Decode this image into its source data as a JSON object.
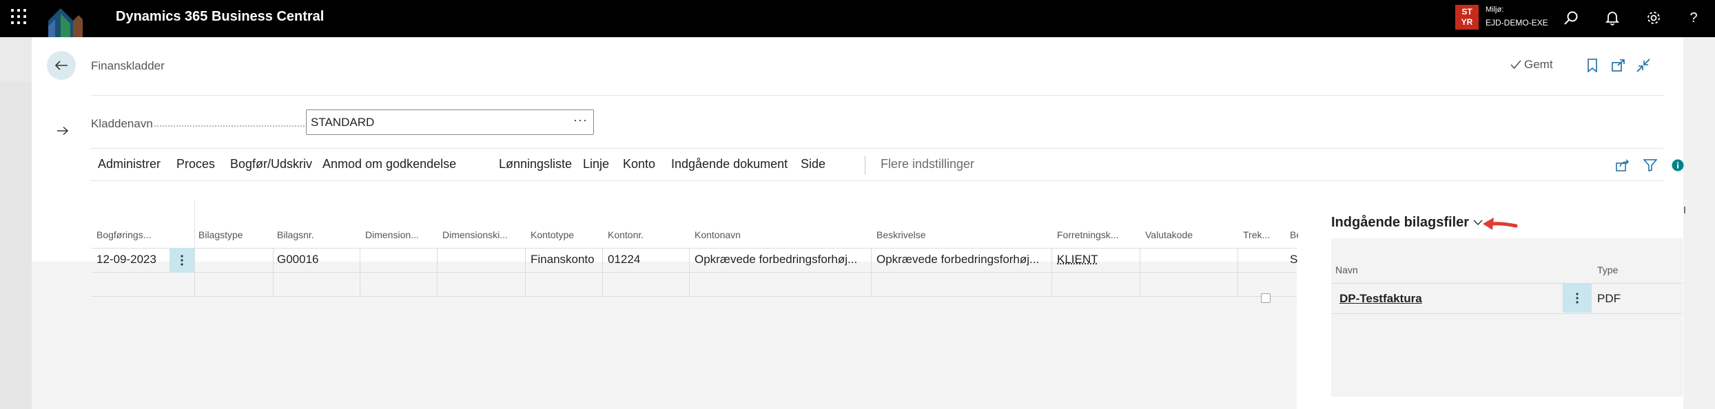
{
  "topbar": {
    "app_title": "Dynamics 365 Business Central",
    "env_badge_line1": "ST",
    "env_badge_line2": "YR",
    "env_label": "Miljø:",
    "env_name": "EJD-DEMO-EXE",
    "icons": [
      "waffle-icon",
      "search-icon",
      "bell-icon",
      "gear-icon",
      "help-icon"
    ],
    "help_glyph": "?"
  },
  "page": {
    "title": "Finanskladder",
    "saved_label": "Gemt",
    "icons": [
      "back-arrow-icon",
      "bookmark-icon",
      "open-new-window-icon",
      "collapse-icon"
    ]
  },
  "field": {
    "label": "Kladdenavn",
    "value": "STANDARD",
    "ellipsis": "···"
  },
  "actions": {
    "items": [
      "Administrer",
      "Proces",
      "Bogfør/Udskriv",
      "Anmod om godkendelse",
      "Lønningsliste",
      "Linje",
      "Konto",
      "Indgående dokument",
      "Side"
    ],
    "more": "Flere indstillinger",
    "icons": [
      "share-icon",
      "filter-icon",
      "info-icon"
    ]
  },
  "grid": {
    "columns": [
      "Bogførings...",
      "Bilagstype",
      "Bilagsnr.",
      "Dimension...",
      "Dimensionski...",
      "Kontotype",
      "Kontonr.",
      "Kontonavn",
      "Beskrivelse",
      "Forretningsk...",
      "Valutakode",
      "Trek...",
      "Be"
    ],
    "rows": [
      {
        "date": "12-09-2023",
        "doc_type": "",
        "doc_no": "G00016",
        "dim1": "",
        "dim2": "",
        "account_type": "Finanskonto",
        "account_no": "01224",
        "account_name": "Opkrævede forbedringsforhøj...",
        "description": "Opkrævede forbedringsforhøj...",
        "business": "KLIENT",
        "currency": "",
        "cut": "",
        "tail": "S"
      }
    ]
  },
  "factbox": {
    "title": "Indgående bilagsfiler",
    "col_name": "Navn",
    "col_type": "Type",
    "files": [
      {
        "name": "DP-Testfaktura",
        "type": "PDF"
      }
    ]
  },
  "colors": {
    "accent": "#008489",
    "env_badge": "#c42b1c",
    "selection": "#c9e6ef",
    "annotation_arrow": "#e03c31"
  }
}
